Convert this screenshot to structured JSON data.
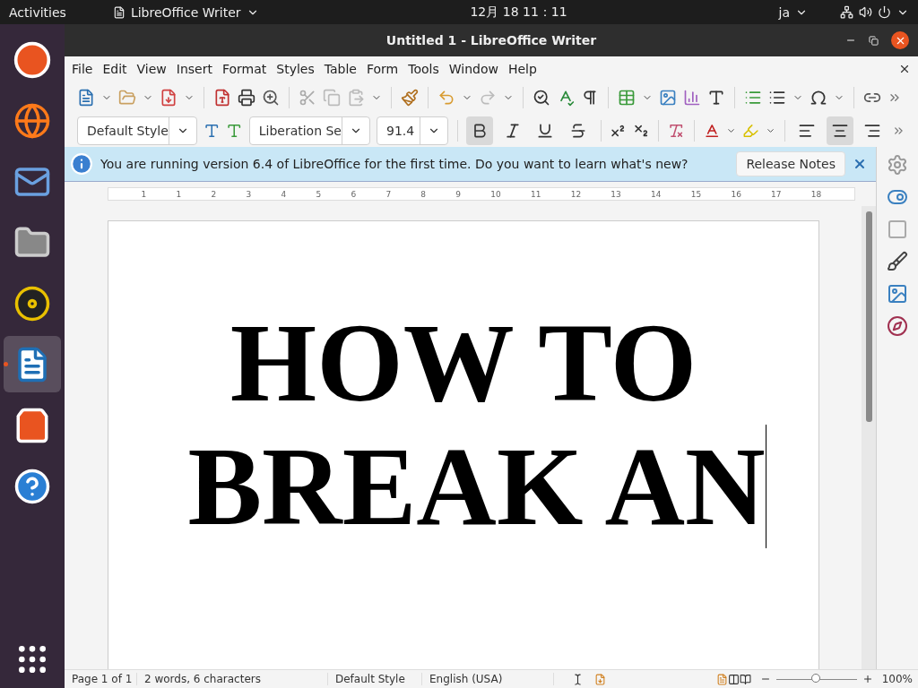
{
  "top_bar": {
    "activities": "Activities",
    "app_menu": "LibreOffice Writer",
    "clock": "12月 18  11：11",
    "input_method": "ja"
  },
  "dock": [
    {
      "kind": "ubuntu",
      "selected": false
    },
    {
      "kind": "browser",
      "selected": false
    },
    {
      "kind": "mail",
      "selected": false
    },
    {
      "kind": "files",
      "selected": false
    },
    {
      "kind": "music",
      "selected": false
    },
    {
      "kind": "writer",
      "selected": true
    },
    {
      "kind": "store",
      "selected": false
    },
    {
      "kind": "help",
      "selected": false
    }
  ],
  "window": {
    "title": "Untitled 1 - LibreOffice Writer"
  },
  "menu": [
    "File",
    "Edit",
    "View",
    "Insert",
    "Format",
    "Styles",
    "Table",
    "Form",
    "Tools",
    "Window",
    "Help"
  ],
  "formatting": {
    "paragraph_style": "Default Style",
    "font_name": "Liberation Se",
    "font_size": "91.4",
    "text_buttons": [
      {
        "kind": "bold",
        "selected": true
      },
      {
        "kind": "italic",
        "selected": false
      },
      {
        "kind": "underline",
        "selected": false
      },
      {
        "kind": "strike",
        "selected": false
      }
    ],
    "align_buttons": [
      {
        "kind": "left",
        "selected": false
      },
      {
        "kind": "center",
        "selected": true
      },
      {
        "kind": "right",
        "selected": false
      }
    ]
  },
  "infobar": {
    "message": "You are running version 6.4 of LibreOffice for the first time. Do you want to learn what's new?",
    "button": "Release Notes"
  },
  "ruler": [
    "1",
    "1",
    "2",
    "3",
    "4",
    "5",
    "6",
    "7",
    "8",
    "9",
    "10",
    "11",
    "12",
    "13",
    "14",
    "15",
    "16",
    "17",
    "18"
  ],
  "document": {
    "lines": [
      "HOW TO",
      "BREAK AN"
    ]
  },
  "status_bar": {
    "page": "Page 1 of 1",
    "words": "2 words, 6 characters",
    "style": "Default Style",
    "language": "English (USA)",
    "zoom": {
      "level": 0.5
    },
    "zoom_text": "100%"
  }
}
